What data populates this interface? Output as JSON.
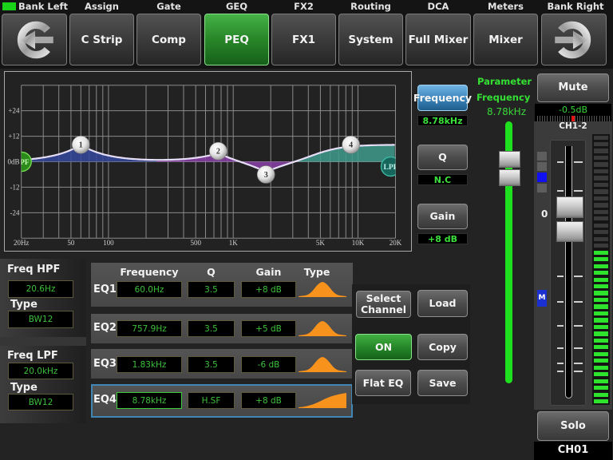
{
  "nav": {
    "indicator_color": "#19d219",
    "items": [
      {
        "alt_label": "Bank Left",
        "label": "",
        "icon": "bank-left-arrow-icon"
      },
      {
        "alt_label": "Assign",
        "label": "C Strip"
      },
      {
        "alt_label": "Gate",
        "label": "Comp"
      },
      {
        "alt_label": "GEQ",
        "label": "PEQ",
        "active": true
      },
      {
        "alt_label": "FX2",
        "label": "FX1"
      },
      {
        "alt_label": "Routing",
        "label": "System"
      },
      {
        "alt_label": "DCA",
        "label": "Full Mixer"
      },
      {
        "alt_label": "Meters",
        "label": "Mixer"
      },
      {
        "alt_label": "Bank Right",
        "label": "",
        "icon": "bank-right-arrow-icon"
      }
    ]
  },
  "chart_data": {
    "type": "line",
    "title": "",
    "xlabel": "",
    "ylabel": "",
    "x_scale": "log",
    "xlim": [
      20,
      20000
    ],
    "ylim": [
      -36,
      36
    ],
    "grid": true,
    "x_ticks": [
      {
        "value": 20,
        "label": "20Hz"
      },
      {
        "value": 50,
        "label": "50"
      },
      {
        "value": 100,
        "label": "100"
      },
      {
        "value": 500,
        "label": "500"
      },
      {
        "value": 1000,
        "label": "1K"
      },
      {
        "value": 5000,
        "label": "5K"
      },
      {
        "value": 10000,
        "label": "10K"
      },
      {
        "value": 20000,
        "label": "20K"
      }
    ],
    "y_ticks": [
      {
        "value": 24,
        "label": "+24"
      },
      {
        "value": 12,
        "label": "+12"
      },
      {
        "value": 0,
        "label": "0dB"
      },
      {
        "value": -12,
        "label": "-12"
      },
      {
        "value": -24,
        "label": "-24"
      }
    ],
    "bands": [
      {
        "id": "1",
        "type": "peak",
        "freq_hz": 60,
        "q": 3.5,
        "gain_db": 8,
        "color": "#34489c"
      },
      {
        "id": "2",
        "type": "peak",
        "freq_hz": 757.9,
        "q": 3.5,
        "gain_db": 5,
        "color": "#8a40a8"
      },
      {
        "id": "3",
        "type": "peak",
        "freq_hz": 1830,
        "q": 3.5,
        "gain_db": -6,
        "color": "#8a40a8"
      },
      {
        "id": "4",
        "type": "high_shelf",
        "freq_hz": 8780,
        "q": null,
        "gain_db": 8,
        "color": "#3f9a8c"
      }
    ],
    "hpf": {
      "label": "HPF",
      "freq_hz": 20.6,
      "color": "#2a8a1a"
    },
    "lpf": {
      "label": "LPF",
      "freq_hz": 20000,
      "color": "#17665c"
    }
  },
  "param_buttons": {
    "frequency": {
      "label": "Frequency",
      "value": "8.78kHz",
      "active": true
    },
    "q": {
      "label": "Q",
      "value": "N.C"
    },
    "gain": {
      "label": "Gain",
      "value": "+8 dB"
    }
  },
  "parameter_slider": {
    "title": "Parameter",
    "name": "Frequency",
    "value": "8.78kHz",
    "position": 0.82
  },
  "filters": {
    "hpf": {
      "freq_label": "Freq HPF",
      "freq": "20.6Hz",
      "type_label": "Type",
      "type": "BW12"
    },
    "lpf": {
      "freq_label": "Freq LPF",
      "freq": "20.0kHz",
      "type_label": "Type",
      "type": "BW12"
    }
  },
  "eq_table": {
    "headers": {
      "frequency": "Frequency",
      "q": "Q",
      "gain": "Gain",
      "type": "Type"
    },
    "rows": [
      {
        "label": "EQ1",
        "frequency": "60.0Hz",
        "q": "3.5",
        "gain": "+8 dB",
        "type_icon": "bell",
        "selected": false
      },
      {
        "label": "EQ2",
        "frequency": "757.9Hz",
        "q": "3.5",
        "gain": "+5 dB",
        "type_icon": "bell",
        "selected": false
      },
      {
        "label": "EQ3",
        "frequency": "1.83kHz",
        "q": "3.5",
        "gain": "-6 dB",
        "type_icon": "bell",
        "selected": false
      },
      {
        "label": "EQ4",
        "frequency": "8.78kHz",
        "q": "H.SF",
        "gain": "+8 dB",
        "type_icon": "high-shelf",
        "selected": true
      }
    ],
    "type_icon_color": "#f7921c"
  },
  "actions": {
    "select_channel": "Select Channel",
    "load": "Load",
    "on": "ON",
    "copy": "Copy",
    "flat_eq": "Flat EQ",
    "save": "Save"
  },
  "channel": {
    "mute": "Mute",
    "gain": "-0.5dB",
    "gain_marker_position": 0.49,
    "strip_name": "CH1-2",
    "indicators": [
      false,
      false,
      true,
      false
    ],
    "fader_label": "0",
    "fader_position": 0.71,
    "mute_badge": "M",
    "meter_segments": 40,
    "meter_level": 0.575,
    "solo": "Solo",
    "name": "CH01"
  }
}
